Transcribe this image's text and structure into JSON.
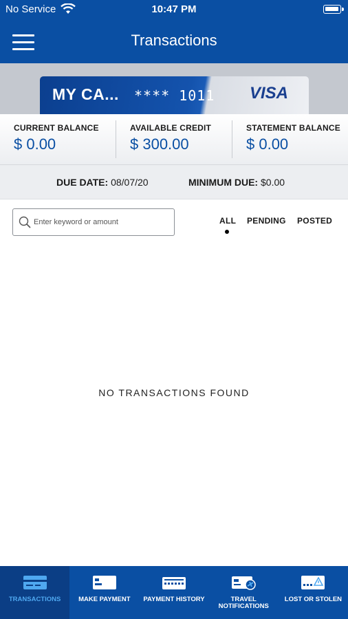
{
  "status_bar": {
    "carrier": "No Service",
    "time": "10:47 PM"
  },
  "header": {
    "title": "Transactions"
  },
  "card": {
    "name": "MY CA...",
    "number": "**** 1011",
    "brand": "VISA"
  },
  "balances": [
    {
      "label": "CURRENT BALANCE",
      "value": "$ 0.00"
    },
    {
      "label": "AVAILABLE CREDIT",
      "value": "$ 300.00"
    },
    {
      "label": "STATEMENT BALANCE",
      "value": "$ 0.00"
    }
  ],
  "due": {
    "date_label": "DUE DATE:",
    "date_value": "08/07/20",
    "min_label": "MINIMUM DUE:",
    "min_value": "$0.00"
  },
  "search": {
    "placeholder": "Enter keyword or amount"
  },
  "filters": {
    "all": "ALL",
    "pending": "PENDING",
    "posted": "POSTED",
    "selected": "ALL"
  },
  "empty_message": "NO TRANSACTIONS FOUND",
  "bottom_nav": [
    {
      "label": "TRANSACTIONS",
      "icon": "card-list-icon",
      "active": true
    },
    {
      "label": "MAKE PAYMENT",
      "icon": "card-icon",
      "active": false
    },
    {
      "label": "PAYMENT HISTORY",
      "icon": "payment-history-icon",
      "active": false
    },
    {
      "label": "TRAVEL NOTIFICATIONS",
      "icon": "travel-card-icon",
      "active": false
    },
    {
      "label": "LOST OR STOLEN",
      "icon": "lost-card-icon",
      "active": false
    }
  ],
  "colors": {
    "primary": "#0a4fa3",
    "active_nav_text": "#4fa8f0",
    "card_band": "#c4c8cf"
  }
}
